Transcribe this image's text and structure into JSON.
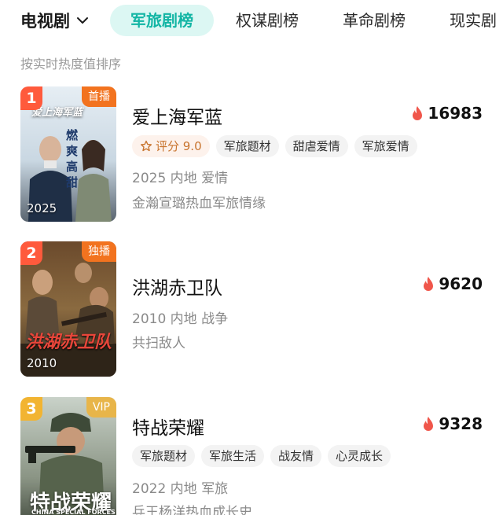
{
  "header": {
    "category": "电视剧",
    "tabs": [
      {
        "label": "军旅剧榜",
        "active": true
      },
      {
        "label": "权谋剧榜",
        "active": false
      },
      {
        "label": "革命剧榜",
        "active": false
      },
      {
        "label": "现实剧",
        "active": false
      }
    ]
  },
  "sort_hint": "按实时热度值排序",
  "items": [
    {
      "rank": "1",
      "corner_badge": "首播",
      "poster_year": "2025",
      "poster_title": "爱上海军蓝",
      "poster_slogan": "燃爽高甜",
      "title": "爱上海军蓝",
      "heat": "16983",
      "score_label": "评分 9.0",
      "tags": [
        "军旅题材",
        "甜虐爱情",
        "军旅爱情"
      ],
      "meta": "2025 内地 爱情",
      "desc": "金瀚宣璐热血军旅情缘"
    },
    {
      "rank": "2",
      "corner_badge": "独播",
      "poster_year": "2010",
      "poster_title": "洪湖赤卫队",
      "title": "洪湖赤卫队",
      "heat": "9620",
      "tags": [],
      "meta": "2010 内地 战争",
      "desc": "共扫敌人"
    },
    {
      "rank": "3",
      "corner_badge": "VIP",
      "poster_title": "特战荣耀",
      "poster_subtitle": "CHINA SPECIAL FORCES",
      "title": "特战荣耀",
      "heat": "9328",
      "tags": [
        "军旅题材",
        "军旅生活",
        "战友情",
        "心灵成长"
      ],
      "meta": "2022 内地 军旅",
      "desc": "兵王杨洋热血成长史"
    }
  ],
  "colors": {
    "accent_teal": "#12b5a4",
    "active_tab_bg": "#dcf7f3",
    "rank_badge": "#ff5a3c",
    "rank3_badge": "#f2b431",
    "corner_orange": "#f2731f",
    "vip_gold": "#e8b54a",
    "heat_flame": "#f0564b",
    "score_text": "#c8742e"
  },
  "icons": {
    "category_chevron": "chevron-down-icon",
    "heat": "flame-icon",
    "score": "star-outline-icon"
  }
}
